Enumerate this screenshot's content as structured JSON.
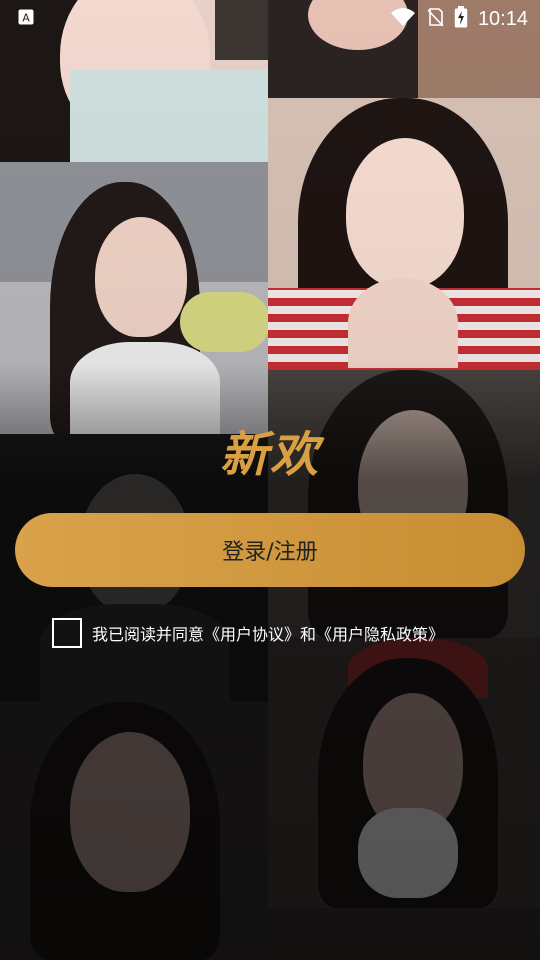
{
  "status_bar": {
    "time": "10:14",
    "icons": [
      "notification-a-icon",
      "wifi-icon",
      "no-sim-icon",
      "battery-charging-icon"
    ]
  },
  "app": {
    "logo": "新欢"
  },
  "login": {
    "button_label": "登录/注册"
  },
  "agreement": {
    "text": "我已阅读并同意《用户协议》和《用户隐私政策》",
    "checked": false
  },
  "colors": {
    "accent": "#d9a043",
    "button": "#d19a40",
    "text": "#ffffff"
  }
}
